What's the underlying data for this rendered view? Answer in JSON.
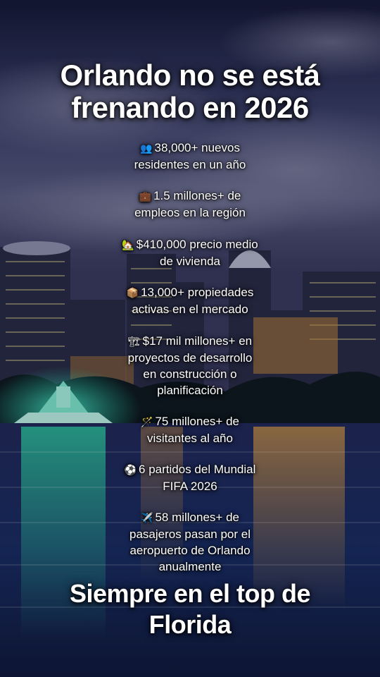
{
  "title": {
    "line1": "Orlando no se está",
    "line2": "frenando en 2026"
  },
  "stats": [
    {
      "icon": "people-icon",
      "glyph": "👥",
      "lines": [
        "38,000+ nuevos",
        "residentes en un año"
      ]
    },
    {
      "icon": "briefcase-icon",
      "glyph": "💼",
      "lines": [
        "1.5 millones+ de",
        "empleos en la región"
      ]
    },
    {
      "icon": "house-icon",
      "glyph": "🏡",
      "lines": [
        "$410,000 precio medio",
        "de vivienda"
      ]
    },
    {
      "icon": "package-icon",
      "glyph": "📦",
      "lines": [
        "13,000+ propiedades",
        "activas en el mercado"
      ]
    },
    {
      "icon": "construction-icon",
      "glyph": "🏗",
      "lines": [
        "$17 mil millones+ en",
        "proyectos de desarrollo",
        "en construcción o",
        "planificación"
      ]
    },
    {
      "icon": "wand-icon",
      "glyph": "🪄",
      "lines": [
        "75 millones+ de",
        "visitantes al año"
      ]
    },
    {
      "icon": "soccer-ball-icon",
      "glyph": "⚽",
      "lines": [
        "6 partidos del Mundial",
        "FIFA 2026"
      ]
    },
    {
      "icon": "airplane-icon",
      "glyph": "✈️",
      "lines": [
        "58 millones+ de",
        "pasajeros pasan por el",
        "aeropuerto de Orlando",
        "anualmente"
      ]
    }
  ],
  "footer": {
    "line1": "Siempre en el top de",
    "line2": "Florida"
  },
  "colors": {
    "sky_top": "#1c2146",
    "sky_mid": "#4a4f78",
    "water": "#1a2c63",
    "fountain_glow": "#27d6b6",
    "text": "#ffffff"
  }
}
